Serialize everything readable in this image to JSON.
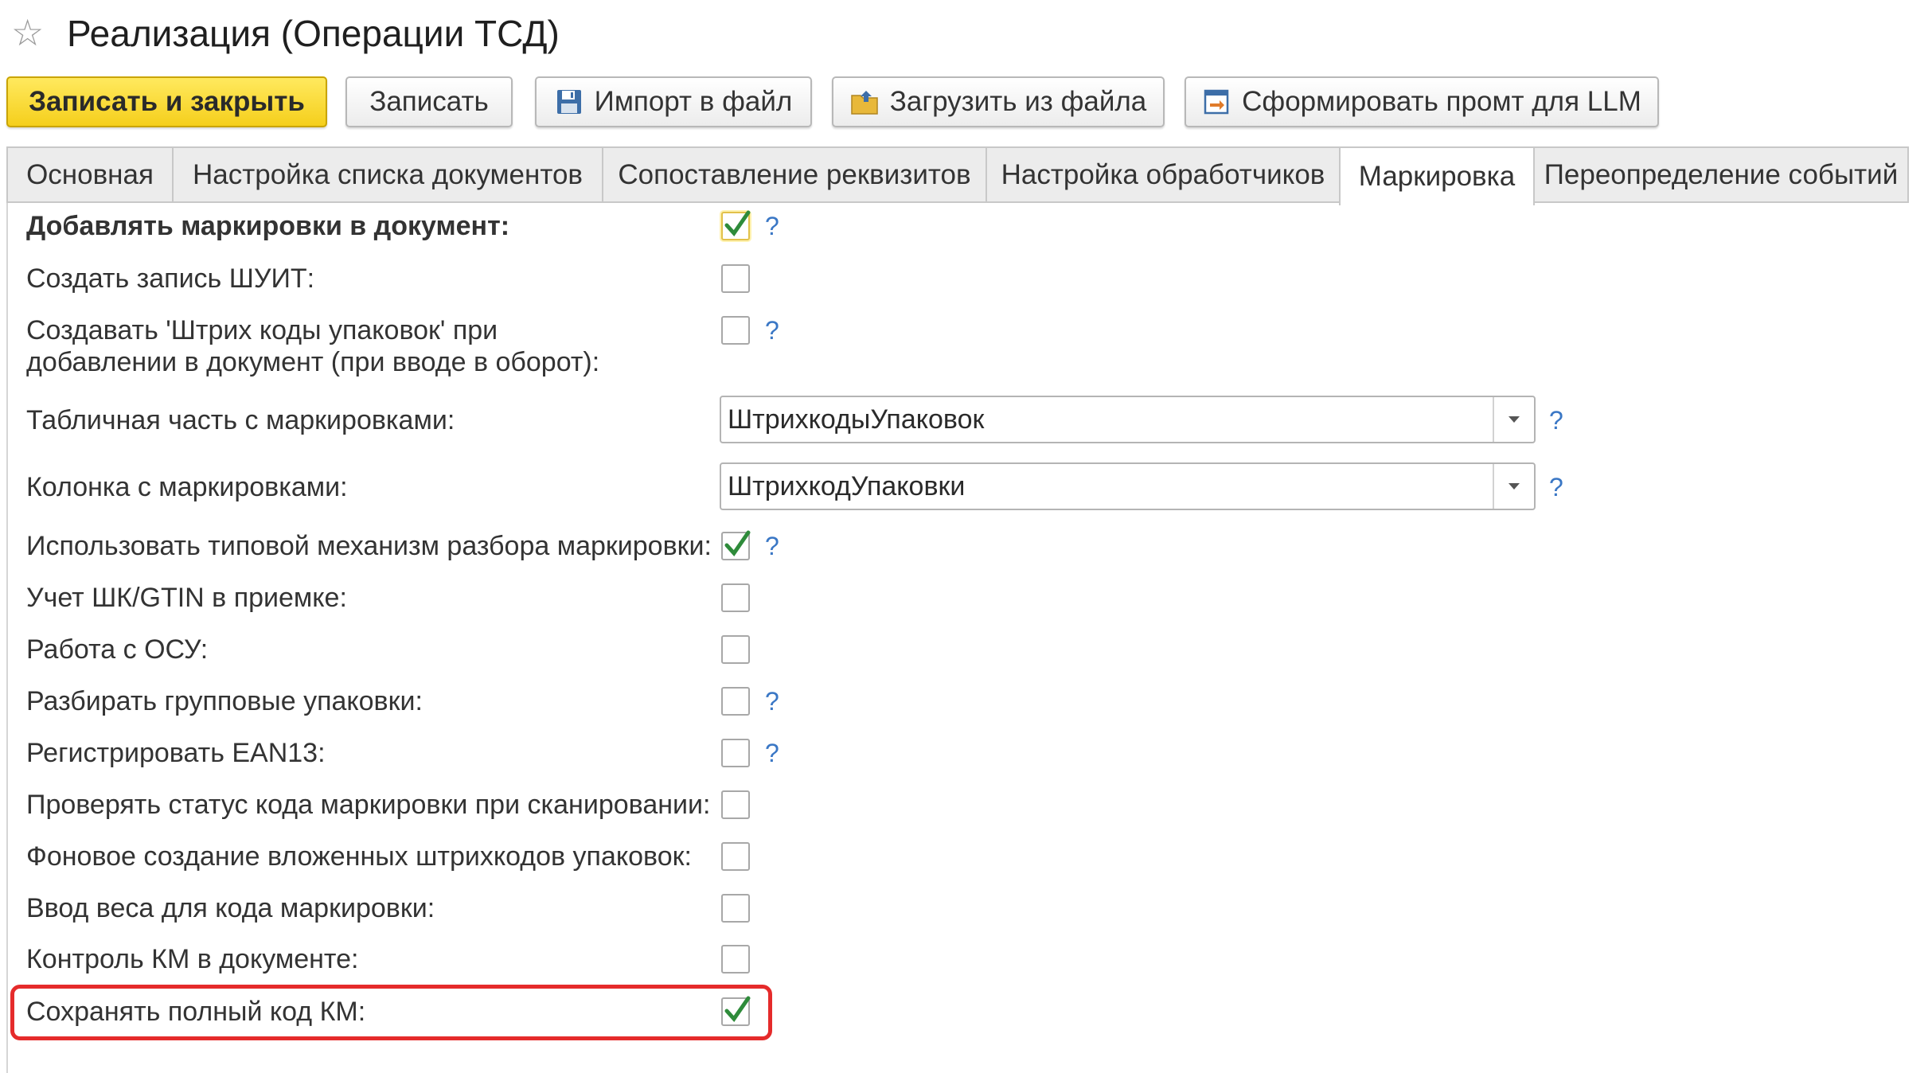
{
  "window": {
    "title": "Реализация (Операции ТСД)"
  },
  "toolbar": {
    "save_close": "Записать и закрыть",
    "save": "Записать",
    "export": "Импорт в файл",
    "import": "Загрузить из файла",
    "prompt": "Сформировать промт для LLM"
  },
  "tabs": [
    {
      "label": "Основная"
    },
    {
      "label": "Настройка списка документов"
    },
    {
      "label": "Сопоставление реквизитов"
    },
    {
      "label": "Настройка обработчиков"
    },
    {
      "label": "Маркировка",
      "active": true
    },
    {
      "label": "Переопределение событий"
    }
  ],
  "form": {
    "rows": [
      {
        "label": "Добавлять маркировки в документ:",
        "checked": true,
        "help": "?"
      },
      {
        "label": "Создать запись ШУИТ:",
        "checked": false
      },
      {
        "label_line1": "Создавать 'Штрих коды упаковок' при",
        "label_line2": "добавлении в документ (при вводе в оборот):",
        "checked": false,
        "help": "?"
      },
      {
        "label": "Табличная часть с маркировками:",
        "value": "ШтрихкодыУпаковок",
        "help": "?"
      },
      {
        "label": "Колонка с маркировками:",
        "value": "ШтрихкодУпаковки",
        "help": "?"
      },
      {
        "label": "Использовать типовой механизм разбора маркировки:",
        "checked": true,
        "help": "?"
      },
      {
        "label": "Учет ШК/GTIN в приемке:",
        "checked": false
      },
      {
        "label": "Работа с ОСУ:",
        "checked": false
      },
      {
        "label": "Разбирать групповые упаковки:",
        "checked": false,
        "help": "?"
      },
      {
        "label": "Регистрировать EAN13:",
        "checked": false,
        "help": "?"
      },
      {
        "label": "Проверять статус кода маркировки при сканировании:",
        "checked": false
      },
      {
        "label": "Фоновое создание вложенных штрихкодов упаковок:",
        "checked": false
      },
      {
        "label": "Ввод веса для кода маркировки:",
        "checked": false
      },
      {
        "label": "Контроль КМ в документе:",
        "checked": false
      },
      {
        "label": "Сохранять полный код КМ:",
        "checked": true
      }
    ]
  },
  "colors": {
    "accent": "#f5cf1c",
    "check": "#2e8b3a",
    "help": "#3a77c5",
    "highlight": "#e52b2b"
  }
}
